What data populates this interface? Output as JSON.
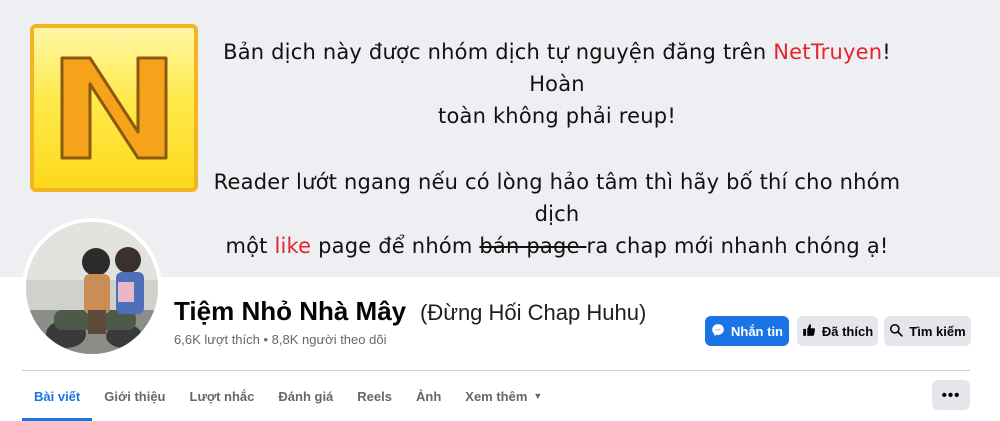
{
  "cover": {
    "line1_before": "Bản dịch này được nhóm dịch tự nguyện đăng trên ",
    "line1_brand": "NetTruyen",
    "line1_after": "! Hoàn",
    "line2": "toàn không phải reup!",
    "line3": "Reader lướt ngang nếu có lòng hảo tâm thì hãy bố thí cho nhóm dịch",
    "line4_before": "một ",
    "line4_like": "like",
    "line4_middle": " page để nhóm ",
    "line4_strike": "bán page ",
    "line4_after": "ra chap mới nhanh chóng ạ!",
    "logo_letter": "N",
    "accent_color": "#e3242b"
  },
  "profile": {
    "name": "Tiệm Nhỏ Nhà Mây",
    "alias": "(Đừng Hối Chap Huhu)",
    "stats": "6,6K lượt thích • 8,8K người theo dõi"
  },
  "actions": {
    "message_label": "Nhắn tin",
    "message_icon": "messenger-icon",
    "liked_label": "Đã thích",
    "liked_icon": "thumbs-up-icon",
    "search_label": "Tìm kiếm",
    "search_icon": "search-icon"
  },
  "tabs": [
    {
      "label": "Bài viết",
      "active": true
    },
    {
      "label": "Giới thiệu"
    },
    {
      "label": "Lượt nhắc"
    },
    {
      "label": "Đánh giá"
    },
    {
      "label": "Reels"
    },
    {
      "label": "Ảnh"
    },
    {
      "label": "Xem thêm"
    }
  ],
  "more_label": "•••",
  "colors": {
    "primary": "#1b74e4",
    "gray_button": "#e4e6eb",
    "cover_bg": "#eeeff3"
  }
}
